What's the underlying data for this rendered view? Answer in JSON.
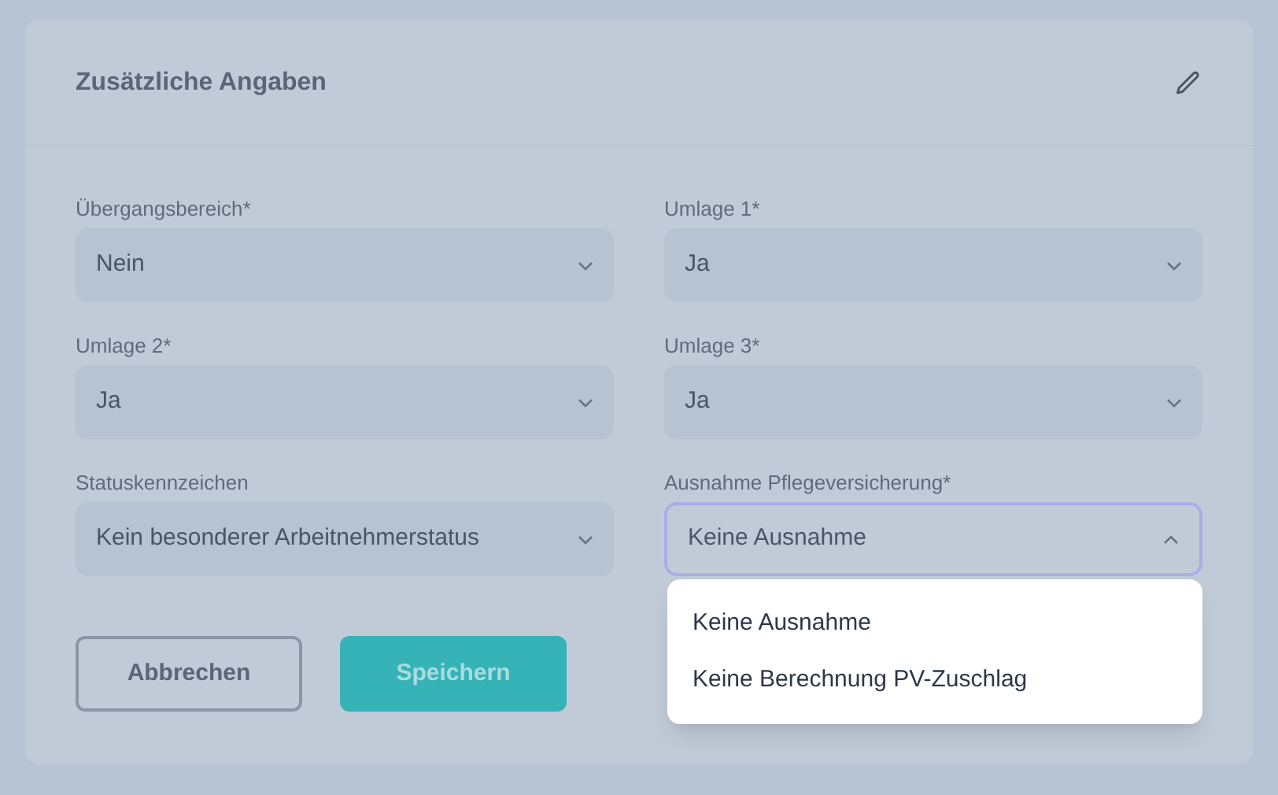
{
  "card": {
    "title": "Zusätzliche Angaben"
  },
  "fields": [
    {
      "label": "Übergangsbereich*",
      "value": "Nein",
      "open": false
    },
    {
      "label": "Umlage 1*",
      "value": "Ja",
      "open": false
    },
    {
      "label": "Umlage 2*",
      "value": "Ja",
      "open": false
    },
    {
      "label": "Umlage 3*",
      "value": "Ja",
      "open": false
    },
    {
      "label": "Statuskennzeichen",
      "value": "Kein besonderer Arbeitnehmerstatus",
      "open": false
    },
    {
      "label": "Ausnahme Pflegeversicherung*",
      "value": "Keine Ausnahme",
      "open": true,
      "options": [
        "Keine Ausnahme",
        "Keine Berechnung PV-Zuschlag"
      ]
    }
  ],
  "buttons": [
    {
      "label": "Abbrechen",
      "kind": "secondary"
    },
    {
      "label": "Speichern",
      "kind": "primary"
    }
  ]
}
